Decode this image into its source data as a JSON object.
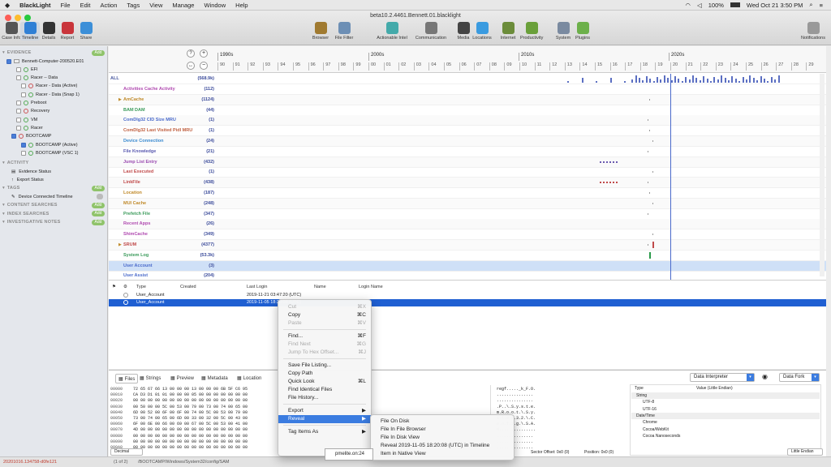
{
  "menubar": {
    "apple": "",
    "app": "BlackLight",
    "items": [
      "File",
      "Edit",
      "Action",
      "Tags",
      "View",
      "Manage",
      "Window",
      "Help"
    ],
    "battery": "100%",
    "datetime": "Wed Oct 21  3:50 PM"
  },
  "window": {
    "title": "beta10.2.4461.Bennett.01.blacklight"
  },
  "toolbar_left": [
    {
      "label": "Case Info",
      "icon": "case-icon",
      "color": "#555"
    },
    {
      "label": "Timeline",
      "icon": "timeline-icon",
      "color": "#2f7fd5"
    },
    {
      "label": "Details",
      "icon": "details-icon",
      "color": "#333"
    },
    {
      "label": "Report",
      "icon": "report-icon",
      "color": "#c9353b"
    },
    {
      "label": "Share",
      "icon": "share-icon",
      "color": "#3c8fd8"
    }
  ],
  "toolbar_center": [
    {
      "label": "Browser",
      "icon": "browser-icon",
      "color": "#a07a30"
    },
    {
      "label": "File Filter",
      "icon": "filter-icon",
      "color": "#6d8fb5"
    },
    {
      "label": "Actionable Intel",
      "icon": "intel-icon",
      "color": "#4aa"
    },
    {
      "label": "Communication",
      "icon": "communication-icon",
      "color": "#777"
    },
    {
      "label": "Media",
      "icon": "media-icon",
      "color": "#444"
    },
    {
      "label": "Locations",
      "icon": "locations-icon",
      "color": "#3a9be0"
    },
    {
      "label": "Internet",
      "icon": "internet-icon",
      "color": "#6b8c3a"
    },
    {
      "label": "Productivity",
      "icon": "productivity-icon",
      "color": "#6aa03a"
    },
    {
      "label": "System",
      "icon": "system-icon",
      "color": "#7a8aa0"
    },
    {
      "label": "Plugins",
      "icon": "plugins-icon",
      "color": "#6cb04a"
    }
  ],
  "toolbar_right": {
    "label": "Notifications",
    "icon": "notifications-icon"
  },
  "sidebar": {
    "evidence_header": "EVIDENCE",
    "add": "Add",
    "tree": [
      {
        "label": "Bennett-Computer-200520.E01",
        "indent": 0,
        "kind": "disk"
      },
      {
        "label": "EFI",
        "indent": 2,
        "kind": "part"
      },
      {
        "label": "Racer -- Data",
        "indent": 2,
        "kind": "part"
      },
      {
        "label": "Racer - Data (Active)",
        "indent": 3,
        "kind": "part"
      },
      {
        "label": "Racer - Data (Snap 1)",
        "indent": 3,
        "kind": "part"
      },
      {
        "label": "Preboot",
        "indent": 2,
        "kind": "part"
      },
      {
        "label": "Recovery",
        "indent": 2,
        "kind": "part"
      },
      {
        "label": "VM",
        "indent": 2,
        "kind": "part"
      },
      {
        "label": "Racer",
        "indent": 2,
        "kind": "part"
      },
      {
        "label": "BOOTCAMP",
        "indent": 1,
        "kind": "part"
      },
      {
        "label": "BOOTCAMP (Active)",
        "indent": 3,
        "kind": "part"
      },
      {
        "label": "BOOTCAMP (VSC 1)",
        "indent": 3,
        "kind": "part"
      }
    ],
    "activity_header": "ACTIVITY",
    "activity": [
      "Evidence Status",
      "Export Status"
    ],
    "tags_header": "TAGS",
    "tags": [
      "Device Connected Timeline"
    ],
    "content_header": "CONTENT SEARCHES",
    "index_header": "INDEX SEARCHES",
    "notes_header": "INVESTIGATIVE NOTES"
  },
  "timeline": {
    "decades": [
      "1990s",
      "2000s",
      "2010s",
      "2020s"
    ],
    "years": [
      "90",
      "91",
      "92",
      "93",
      "94",
      "95",
      "96",
      "97",
      "98",
      "99",
      "00",
      "01",
      "02",
      "03",
      "04",
      "05",
      "06",
      "07",
      "08",
      "09",
      "10",
      "11",
      "12",
      "13",
      "14",
      "15",
      "16",
      "17",
      "18",
      "19",
      "20",
      "21",
      "22",
      "23",
      "24",
      "25",
      "26",
      "27",
      "28",
      "29"
    ],
    "all_label": "ALL",
    "all_count": "(568.9k)",
    "rows": [
      {
        "label": "Activities Cache Activity",
        "count": "(112)",
        "color": "#b04ab0"
      },
      {
        "label": "AmCache",
        "count": "(1124)",
        "color": "#c08a2a",
        "expand": "▶"
      },
      {
        "label": "BAM DAM",
        "count": "(44)",
        "color": "#3a9a5a"
      },
      {
        "label": "ComDlg32 CID Size MRU",
        "count": "(1)",
        "color": "#4a6acb"
      },
      {
        "label": "ComDlg32 Last Visited Pidl MRU",
        "count": "(1)",
        "color": "#c06040"
      },
      {
        "label": "Device Connection",
        "count": "(24)",
        "color": "#3a8ad0"
      },
      {
        "label": "File Knowledge",
        "count": "(21)",
        "color": "#5a5ab0"
      },
      {
        "label": "Jump List Entry",
        "count": "(432)",
        "color": "#9a4ab0"
      },
      {
        "label": "Last Executed",
        "count": "(1)",
        "color": "#c04a4a"
      },
      {
        "label": "LinkFile",
        "count": "(438)",
        "color": "#c04a4a"
      },
      {
        "label": "Location",
        "count": "(187)",
        "color": "#c08a2a"
      },
      {
        "label": "MUI Cache",
        "count": "(248)",
        "color": "#c08a2a"
      },
      {
        "label": "Prefetch File",
        "count": "(347)",
        "color": "#3a9a5a"
      },
      {
        "label": "Recent Apps",
        "count": "(26)",
        "color": "#b04ab0"
      },
      {
        "label": "ShimCache",
        "count": "(349)",
        "color": "#b04ab0"
      },
      {
        "label": "SRUM",
        "count": "(4377)",
        "color": "#c04a4a",
        "expand": "▶"
      },
      {
        "label": "System Log",
        "count": "(53.3k)",
        "color": "#3a9a5a"
      },
      {
        "label": "User Account",
        "count": "(3)",
        "color": "#4a6acb",
        "selected": true
      },
      {
        "label": "User Assist",
        "count": "(204)",
        "color": "#4a6acb"
      }
    ]
  },
  "table": {
    "columns": [
      "Type",
      "Created",
      "Last Login",
      "Name",
      "Login Name"
    ],
    "rows": [
      {
        "type": "User_Account",
        "created": "",
        "last_login": "2019-11-21 03:47:20 (UTC)",
        "name": "",
        "login": ""
      },
      {
        "type": "User_Account",
        "created": "",
        "last_login": "2019-11-05 18:20:08 (UTC)",
        "name": "",
        "login": "",
        "selected": true
      }
    ]
  },
  "context_menu": {
    "items": [
      {
        "label": "Cut",
        "shortcut": "⌘X",
        "disabled": true
      },
      {
        "label": "Copy",
        "shortcut": "⌘C"
      },
      {
        "label": "Paste",
        "shortcut": "⌘V",
        "disabled": true
      },
      {
        "sep": true
      },
      {
        "label": "Find...",
        "shortcut": "⌘F"
      },
      {
        "label": "Find Next",
        "shortcut": "⌘G",
        "disabled": true
      },
      {
        "label": "Jump To Hex Offset...",
        "shortcut": "⌘J",
        "disabled": true
      },
      {
        "sep": true
      },
      {
        "label": "Save File Listing..."
      },
      {
        "label": "Copy Path"
      },
      {
        "label": "Quick Look",
        "shortcut": "⌘L"
      },
      {
        "label": "Find Identical Files"
      },
      {
        "label": "File History..."
      },
      {
        "sep": true
      },
      {
        "label": "Export",
        "arrow": "▶"
      },
      {
        "label": "Reveal",
        "arrow": "▶",
        "selected": true
      },
      {
        "sep": true
      },
      {
        "label": "Tag Items As",
        "arrow": "▶"
      }
    ]
  },
  "submenu": {
    "items": [
      "File On Disk",
      "File In File Browser",
      "File In Disk View",
      "Reveal 2019-11-05 18:20:08 (UTC) in Timeline",
      "Item in Native View"
    ]
  },
  "tooltip": "pmelite.on:24",
  "bottom_tabs": [
    "Files",
    "Strings",
    "Preview",
    "Metadata",
    "Location"
  ],
  "hex": {
    "offsets": [
      "00000",
      "00010",
      "00020",
      "00030",
      "00040",
      "00050",
      "00060",
      "00070",
      "00080",
      "00090",
      "000A0"
    ],
    "lines": [
      "72 65 67 66 13 00 00 00 13 00 00 00 6B 5F C6 95",
      "CA D3 D1 01 01 00 00 00 05 00 00 00 00 00 00 00",
      "00 00 00 00 00 00 00 00 00 00 00 00 00 00 00 00",
      "00 50 00 00 5C 00 53 00 79 00 73 00 74 00 65 00",
      "6D 00 52 00 6F 00 6F 00 74 00 5C 00 53 00 79 00",
      "73 00 74 00 65 00 6D 00 33 00 32 00 5C 00 43 00",
      "6F 00 6E 00 66 00 69 00 67 00 5C 00 53 00 41 00",
      "4D 00 00 00 00 00 00 00 00 00 00 00 00 00 00 00",
      "00 00 00 00 00 00 00 00 00 00 00 00 00 00 00 00",
      "00 00 00 00 00 00 00 00 00 00 00 00 00 00 00 00",
      "00 00 00 00 00 00 00 00 00 00 00 00 00 00 00 00"
    ],
    "ascii": [
      "regf....._k_F.O.",
      "...............",
      "...............",
      ".P..\\.S.y.s.t.e.",
      "m.R.o.o.t.\\.S.y.",
      "s.t.e.m.3.2.\\.C.",
      "o.n.f.i.g.\\.S.A.",
      "M...............",
      "...............",
      "...............",
      "..............."
    ]
  },
  "interpreter": {
    "dropdown": "Data Interpreter",
    "fork": "Data Fork",
    "col_type": "Type",
    "col_value": "Value (Little Endian)",
    "rows": [
      {
        "label": "String",
        "group": true
      },
      {
        "label": "UTF-8"
      },
      {
        "label": "UTF-16"
      },
      {
        "label": "Date/Time",
        "group": true
      },
      {
        "label": "Chrome"
      },
      {
        "label": "Cocoa/WebKit"
      },
      {
        "label": "Cocoa Nanoseconds"
      }
    ],
    "endian": "Little Endian"
  },
  "hexfooter": {
    "decimal": "Decimal",
    "sector": "Sector Offset: 0x0 (0)",
    "position": "Position: 0x0 (0)"
  },
  "statusbar": {
    "left": "20201016.134758-d0fe121",
    "count": "(1 of 2)",
    "path": "/BOOTCAMP/Windows/System32/config/SAM"
  }
}
